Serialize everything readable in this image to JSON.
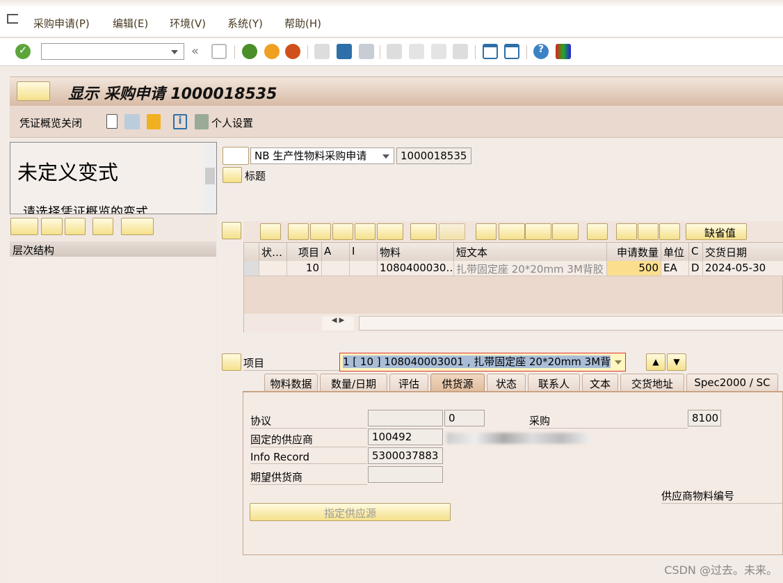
{
  "menu": {
    "items": [
      {
        "label": "采购申请(P)"
      },
      {
        "label": "编辑(E)"
      },
      {
        "label": "环境(V)"
      },
      {
        "label": "系统(Y)"
      },
      {
        "label": "帮助(H)"
      }
    ]
  },
  "toolbar": {
    "command_field": "",
    "icons": [
      "enter-icon",
      "back-arrows-icon",
      "save-icon",
      "back-icon",
      "exit-icon",
      "cancel-icon",
      "print-icon",
      "find-icon",
      "find-next-icon",
      "first-page-icon",
      "prev-page-icon",
      "next-page-icon",
      "last-page-icon",
      "new-session-icon",
      "shortcut-icon",
      "help-icon",
      "layout-icon"
    ]
  },
  "header": {
    "title": "显示 采购申请 1000018535"
  },
  "app_toolbar": {
    "close_overview": "凭证概览关闭",
    "personal_settings": "个人设置"
  },
  "left_panel": {
    "variant_title": "未定义变式",
    "variant_hint": "请选择凭证概览的变式",
    "hierarchy_header": "层次结构"
  },
  "doc": {
    "type": "NB 生产性物料采购申请",
    "number": "1000018535",
    "header_label": "标题"
  },
  "grid": {
    "toolbar": {
      "default_values": "缺省值"
    },
    "columns": [
      "状…",
      "项目",
      "A",
      "I",
      "物料",
      "短文本",
      "申请数量",
      "单位",
      "C",
      "交货日期"
    ],
    "rows": [
      {
        "status": "",
        "item": "10",
        "a": "",
        "i": "",
        "material": "1080400030…",
        "short_text": "扎带固定座 20*20mm 3M背胶",
        "quantity": "500",
        "unit": "EA",
        "c": "D",
        "delivery_date": "2024-05-30"
      }
    ]
  },
  "item": {
    "label": "项目",
    "selected": "1 [ 10 ] 108040003001 , 扎带固定座 20*20mm 3M背"
  },
  "tabs": [
    {
      "label": "物料数据"
    },
    {
      "label": "数量/日期"
    },
    {
      "label": "评估"
    },
    {
      "label": "供货源",
      "active": true
    },
    {
      "label": "状态"
    },
    {
      "label": "联系人"
    },
    {
      "label": "文本"
    },
    {
      "label": "交货地址"
    },
    {
      "label": "Spec2000 / SC"
    }
  ],
  "source": {
    "agreement_label": "协议",
    "agreement": "",
    "agreement_item": "0",
    "purch_org_label": "采购",
    "purch_org": "8100",
    "fixed_vendor_label": "固定的供应商",
    "fixed_vendor": "100492",
    "info_record_label": "Info Record",
    "info_record": "5300037883",
    "desired_vendor_label": "期望供货商",
    "desired_vendor": "",
    "vendor_material_label": "供应商物料编号",
    "assign_button": "指定供应源"
  },
  "watermark": "CSDN @过去。未来。"
}
